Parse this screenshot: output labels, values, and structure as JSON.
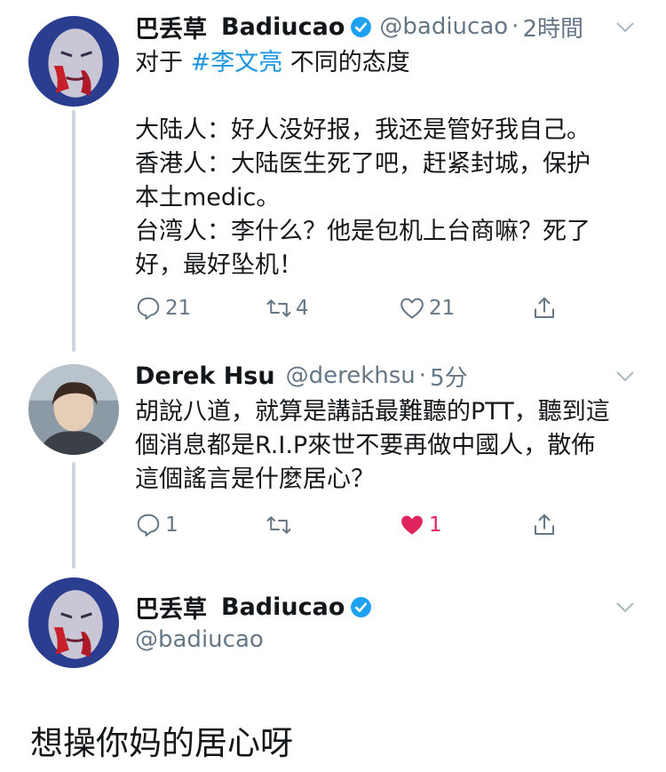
{
  "tweets": [
    {
      "display_name": "巴丢草",
      "display_name_latin": "Badiucao",
      "handle": "@badiucao",
      "dot": "·",
      "time": "2時間",
      "text_pre": "对于 ",
      "hashtag": "#李文亮",
      "text_post": " 不同的态度",
      "body": "大陆人：好人没好报，我还是管好我自己。\n香港人：大陆医生死了吧，赶紧封城，保护\n本土medic。\n台湾人：李什么？他是包机上台商嘛？死了\n好，最好坠机！",
      "reply_count": "21",
      "retweet_count": "4",
      "like_count": "21"
    },
    {
      "display_name": "Derek Hsu",
      "handle": "@derekhsu",
      "dot": "·",
      "time": "5分",
      "body": "胡說八道，就算是講話最難聽的PTT，聽到這\n個消息都是R.I.P來世不要再做中國人，散佈\n這個謠言是什麼居心？",
      "reply_count": "1",
      "retweet_count": "",
      "like_count": "1",
      "liked": true
    },
    {
      "display_name": "巴丢草",
      "display_name_latin": "Badiucao",
      "handle": "@badiucao",
      "body": "想操你妈的居心呀"
    }
  ],
  "colors": {
    "link": "#1b95e0",
    "muted": "#657786",
    "like_active": "#e0245e",
    "verified": "#1da1f2",
    "thread_line": "#cdd6dd"
  },
  "icons": [
    "reply-icon",
    "retweet-icon",
    "like-icon",
    "share-icon",
    "verified-icon",
    "chevron-down-icon"
  ]
}
